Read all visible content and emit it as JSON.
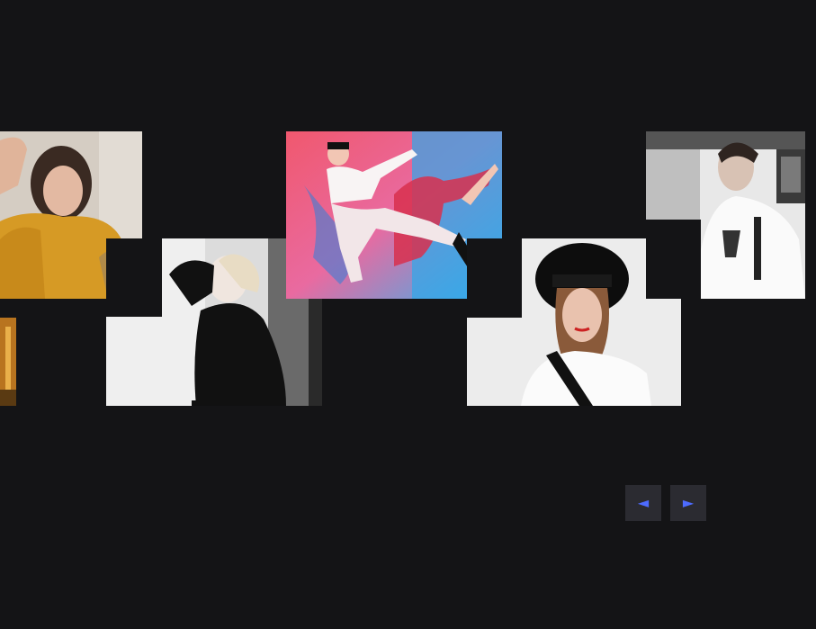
{
  "gallery": {
    "photos": [
      {
        "id": "p1",
        "alt": "woman-in-mustard-hoodie"
      },
      {
        "id": "p2",
        "alt": "bw-woman-posing"
      },
      {
        "id": "p3",
        "alt": "dancer-neon-shadow"
      },
      {
        "id": "p4",
        "alt": "woman-black-hat"
      },
      {
        "id": "p5",
        "alt": "man-white-jacket"
      },
      {
        "id": "p6",
        "alt": "partial-photo"
      }
    ]
  },
  "nav": {
    "prev_icon": "◄",
    "next_icon": "►",
    "accent_color": "#4d6bff"
  },
  "colors": {
    "background": "#141416",
    "button_bg": "#2b2b31"
  }
}
